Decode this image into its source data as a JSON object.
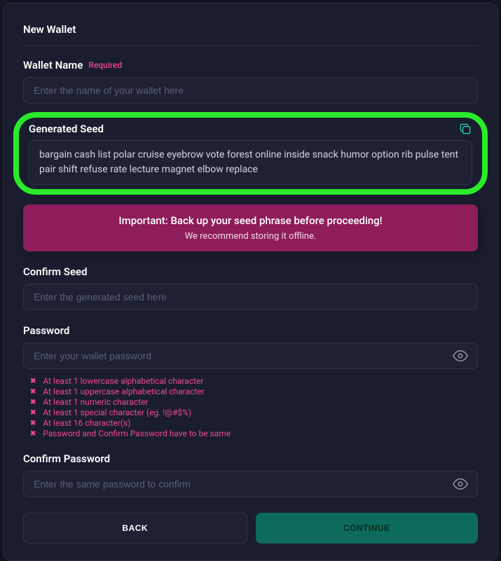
{
  "title": "New Wallet",
  "walletName": {
    "label": "Wallet Name",
    "required": "Required",
    "placeholder": "Enter the name of your wallet here"
  },
  "seed": {
    "label": "Generated Seed",
    "value": "bargain cash list polar cruise eyebrow vote forest online inside snack humor option rib pulse tent pair shift refuse rate lecture magnet elbow replace"
  },
  "warning": {
    "title": "Important: Back up your seed phrase before proceeding!",
    "sub": "We recommend storing it offline."
  },
  "confirmSeed": {
    "label": "Confirm Seed",
    "placeholder": "Enter the generated seed here"
  },
  "password": {
    "label": "Password",
    "placeholder": "Enter your wallet password",
    "rules": [
      "At least 1 lowercase alphabetical character",
      "At least 1 uppercase alphabetical character",
      "At least 1 numeric character",
      "At least 1 special character (eg. !@#$%)",
      "At least 16 character(s)",
      "Password and Confirm Password have to be same"
    ]
  },
  "confirmPassword": {
    "label": "Confirm Password",
    "placeholder": "Enter the same password to confirm"
  },
  "buttons": {
    "back": "BACK",
    "continue": "CONTINUE"
  }
}
